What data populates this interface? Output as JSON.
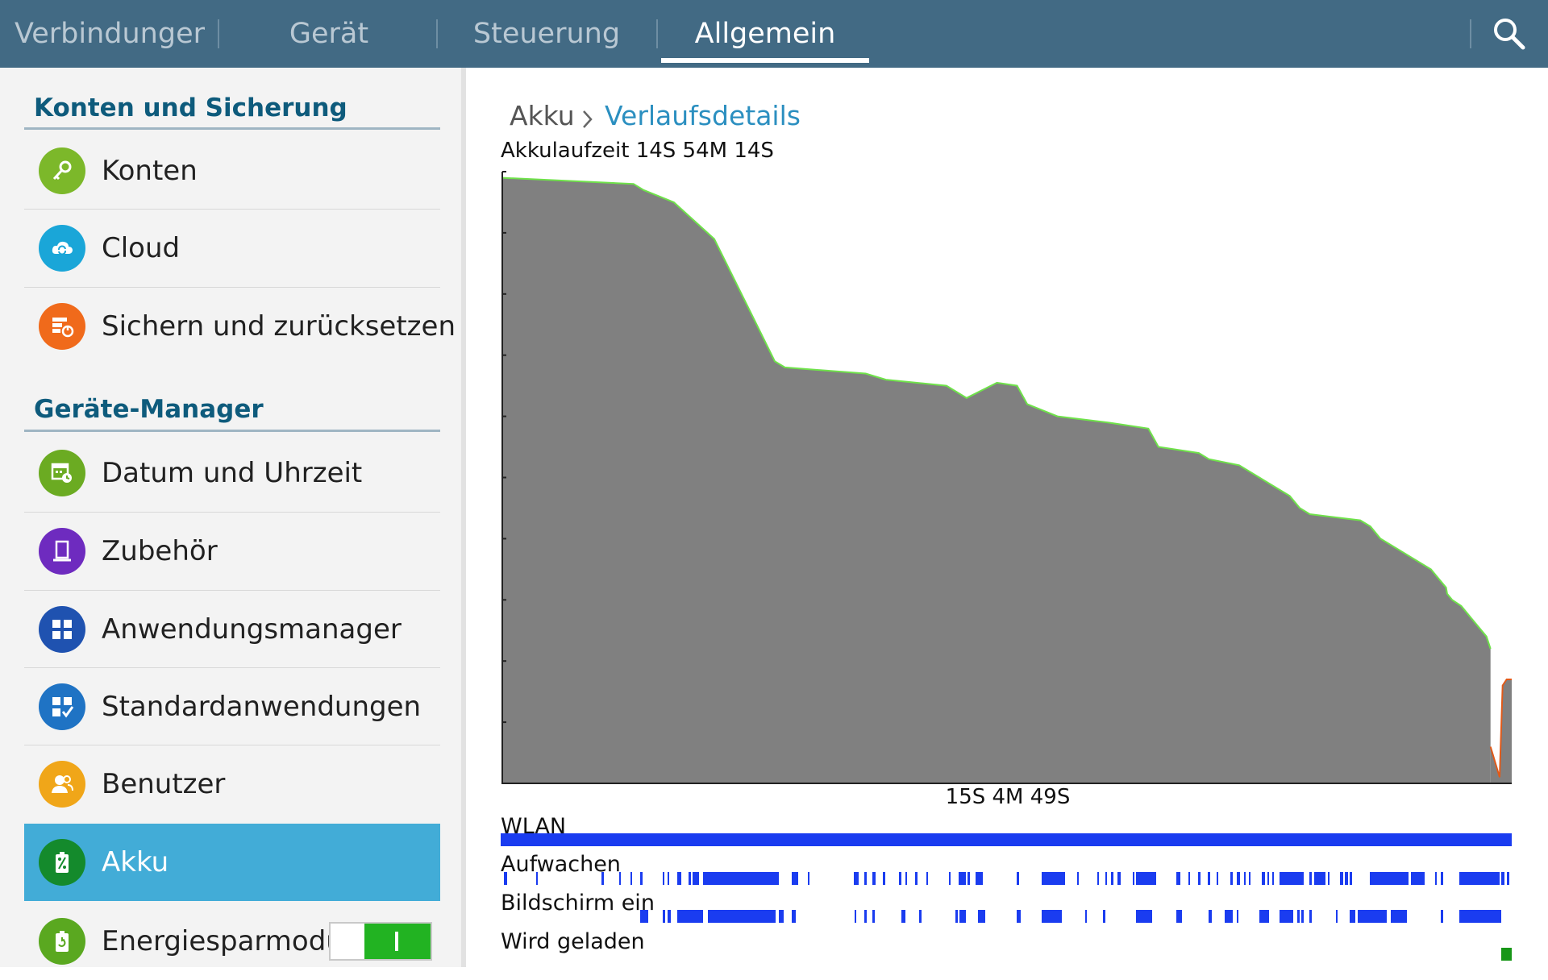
{
  "top_tabs": [
    {
      "label": "Verbindungen",
      "active": false
    },
    {
      "label": "Gerät",
      "active": false
    },
    {
      "label": "Steuerung",
      "active": false
    },
    {
      "label": "Allgemein",
      "active": true
    }
  ],
  "search_icon": "search-icon",
  "sidebar": {
    "sections": [
      {
        "title": "Konten und Sicherung",
        "items": [
          {
            "label": "Konten",
            "icon": "key-icon",
            "color": "#7cb82a"
          },
          {
            "label": "Cloud",
            "icon": "cloud-sync-icon",
            "color": "#1aa6d8"
          },
          {
            "label": "Sichern und zurücksetzen",
            "icon": "backup-icon",
            "color": "#f06a1b"
          }
        ]
      },
      {
        "title": "Geräte-Manager",
        "items": [
          {
            "label": "Datum und Uhrzeit",
            "icon": "calendar-clock-icon",
            "color": "#6bab22"
          },
          {
            "label": "Zubehör",
            "icon": "accessory-icon",
            "color": "#6e2bbf"
          },
          {
            "label": "Anwendungsmanager",
            "icon": "apps-grid-icon",
            "color": "#1f52b0"
          },
          {
            "label": "Standardanwendungen",
            "icon": "default-apps-icon",
            "color": "#1f73c4"
          },
          {
            "label": "Benutzer",
            "icon": "users-icon",
            "color": "#f0a619"
          },
          {
            "label": "Akku",
            "icon": "battery-percent-icon",
            "color": "#148a2c",
            "selected": true
          },
          {
            "label": "Energiesparmodus",
            "icon": "power-saving-icon",
            "color": "#5aa820",
            "toggle": true
          }
        ]
      }
    ]
  },
  "breadcrumb": {
    "parent": "Akku",
    "current": "Verlaufsdetails"
  },
  "battery_runtime": "Akkulaufzeit 14S 54M 14S",
  "chart_data": {
    "type": "area",
    "title": "Akkulaufzeit 14S 54M 14S",
    "xlabel": "15S 4M 49S",
    "ylabel": "",
    "x_range": [
      0,
      1
    ],
    "ylim": [
      0,
      100
    ],
    "series": [
      {
        "line_color": "#6fe24a",
        "fill_color": "#808080",
        "points": [
          [
            0,
            99
          ],
          [
            0.13,
            98
          ],
          [
            0.14,
            97
          ],
          [
            0.17,
            95
          ],
          [
            0.21,
            89
          ],
          [
            0.24,
            79
          ],
          [
            0.27,
            69
          ],
          [
            0.28,
            68
          ],
          [
            0.36,
            67
          ],
          [
            0.38,
            66
          ],
          [
            0.44,
            65
          ],
          [
            0.46,
            63
          ],
          [
            0.49,
            65.5
          ],
          [
            0.51,
            65
          ],
          [
            0.52,
            62
          ],
          [
            0.55,
            60
          ],
          [
            0.6,
            59
          ],
          [
            0.64,
            58
          ],
          [
            0.65,
            55
          ],
          [
            0.69,
            54
          ],
          [
            0.7,
            53
          ],
          [
            0.73,
            52
          ],
          [
            0.75,
            50
          ],
          [
            0.76,
            49
          ],
          [
            0.78,
            47
          ],
          [
            0.79,
            45
          ],
          [
            0.8,
            44
          ],
          [
            0.85,
            43
          ],
          [
            0.86,
            42
          ],
          [
            0.87,
            40
          ],
          [
            0.9,
            37
          ],
          [
            0.92,
            35
          ],
          [
            0.935,
            32
          ],
          [
            0.936,
            31
          ],
          [
            0.941,
            30
          ],
          [
            0.95,
            29
          ],
          [
            0.96,
            27
          ],
          [
            0.975,
            24
          ],
          [
            0.979,
            22
          ]
        ]
      },
      {
        "line_color": "#e05a1a",
        "fill_color": "#808080",
        "points": [
          [
            0.979,
            6
          ],
          [
            0.988,
            1
          ],
          [
            0.991,
            16
          ],
          [
            0.995,
            17
          ],
          [
            1,
            17
          ]
        ]
      }
    ]
  },
  "tracks": [
    {
      "label": "WLAN",
      "color": "#1a3cf0",
      "segments": [
        [
          0,
          1
        ]
      ]
    },
    {
      "label": "Aufwachen",
      "color": "#1a3cf0",
      "segments": [
        [
          0.003,
          0.006
        ],
        [
          0.035,
          0.037
        ],
        [
          0.1,
          0.102
        ],
        [
          0.117,
          0.119
        ],
        [
          0.128,
          0.13
        ],
        [
          0.138,
          0.14
        ],
        [
          0.16,
          0.161
        ],
        [
          0.165,
          0.167
        ],
        [
          0.175,
          0.179
        ],
        [
          0.186,
          0.188
        ],
        [
          0.19,
          0.196
        ],
        [
          0.2,
          0.275
        ],
        [
          0.288,
          0.294
        ],
        [
          0.304,
          0.305
        ],
        [
          0.349,
          0.354
        ],
        [
          0.36,
          0.362
        ],
        [
          0.368,
          0.371
        ],
        [
          0.378,
          0.38
        ],
        [
          0.394,
          0.396
        ],
        [
          0.4,
          0.402
        ],
        [
          0.41,
          0.412
        ],
        [
          0.421,
          0.423
        ],
        [
          0.443,
          0.445
        ],
        [
          0.453,
          0.46
        ],
        [
          0.462,
          0.464
        ],
        [
          0.47,
          0.477
        ],
        [
          0.51,
          0.513
        ],
        [
          0.535,
          0.558
        ],
        [
          0.57,
          0.572
        ],
        [
          0.59,
          0.592
        ],
        [
          0.598,
          0.6
        ],
        [
          0.604,
          0.606
        ],
        [
          0.61,
          0.613
        ],
        [
          0.625,
          0.627
        ],
        [
          0.628,
          0.648
        ],
        [
          0.668,
          0.672
        ],
        [
          0.68,
          0.682
        ],
        [
          0.69,
          0.692
        ],
        [
          0.699,
          0.702
        ],
        [
          0.708,
          0.71
        ],
        [
          0.722,
          0.724
        ],
        [
          0.728,
          0.731
        ],
        [
          0.735,
          0.737
        ],
        [
          0.74,
          0.742
        ],
        [
          0.753,
          0.756
        ],
        [
          0.758,
          0.76
        ],
        [
          0.763,
          0.765
        ],
        [
          0.77,
          0.794
        ],
        [
          0.8,
          0.802
        ],
        [
          0.805,
          0.816
        ],
        [
          0.818,
          0.82
        ],
        [
          0.83,
          0.833
        ],
        [
          0.835,
          0.838
        ],
        [
          0.84,
          0.842
        ],
        [
          0.86,
          0.898
        ],
        [
          0.9,
          0.914
        ],
        [
          0.924,
          0.926
        ],
        [
          0.93,
          0.932
        ],
        [
          0.948,
          0.988
        ],
        [
          0.99,
          0.993
        ],
        [
          0.995,
          0.998
        ]
      ]
    },
    {
      "label": "Bildschirm ein",
      "color": "#1a3cf0",
      "segments": [
        [
          0.138,
          0.146
        ],
        [
          0.16,
          0.163
        ],
        [
          0.165,
          0.168
        ],
        [
          0.175,
          0.2
        ],
        [
          0.205,
          0.272
        ],
        [
          0.275,
          0.28
        ],
        [
          0.288,
          0.292
        ],
        [
          0.35,
          0.352
        ],
        [
          0.36,
          0.362
        ],
        [
          0.368,
          0.37
        ],
        [
          0.396,
          0.4
        ],
        [
          0.414,
          0.416
        ],
        [
          0.45,
          0.452
        ],
        [
          0.454,
          0.46
        ],
        [
          0.472,
          0.479
        ],
        [
          0.51,
          0.514
        ],
        [
          0.535,
          0.555
        ],
        [
          0.578,
          0.58
        ],
        [
          0.596,
          0.598
        ],
        [
          0.628,
          0.644
        ],
        [
          0.668,
          0.674
        ],
        [
          0.7,
          0.703
        ],
        [
          0.716,
          0.724
        ],
        [
          0.728,
          0.73
        ],
        [
          0.75,
          0.76
        ],
        [
          0.77,
          0.784
        ],
        [
          0.788,
          0.79
        ],
        [
          0.792,
          0.794
        ],
        [
          0.8,
          0.802
        ],
        [
          0.826,
          0.828
        ],
        [
          0.84,
          0.845
        ],
        [
          0.848,
          0.876
        ],
        [
          0.88,
          0.896
        ],
        [
          0.93,
          0.932
        ],
        [
          0.948,
          0.99
        ]
      ]
    },
    {
      "label": "Wird geladen",
      "color": "#179617",
      "segments": [
        [
          0.99,
          1
        ]
      ]
    }
  ]
}
